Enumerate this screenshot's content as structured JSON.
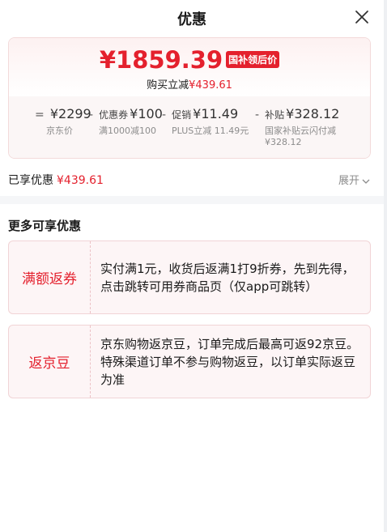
{
  "header": {
    "title": "优惠"
  },
  "price_card": {
    "final_price": "¥1859.39",
    "final_tag": "国补领后价",
    "save_label": "购买立减",
    "save_amount": "¥439.61",
    "breakdown": [
      {
        "op": "=",
        "prefix": "",
        "value": "¥2299",
        "caption": "京东价"
      },
      {
        "op": "-",
        "prefix": "优惠券",
        "value": "¥100",
        "caption": "满1000减100"
      },
      {
        "op": "-",
        "prefix": "促销",
        "value": "¥11.49",
        "caption": "PLUS立减 11.49元"
      },
      {
        "op": "-",
        "prefix": "补贴",
        "value": "¥328.12",
        "caption": "国家补贴云闪付减¥328.12"
      }
    ]
  },
  "summary": {
    "label": "已享优惠",
    "amount": "¥439.61",
    "expand_label": "展开"
  },
  "more": {
    "title": "更多可享优惠",
    "items": [
      {
        "name": "满额返券",
        "desc": "实付满1元，收货后返满1打9折券，先到先得，点击跳转可用券商品页（仅app可跳转）"
      },
      {
        "name": "返京豆",
        "desc": "京东购物返京豆，订单完成后最高可返92京豆。特殊渠道订单不参与购物返豆，以订单实际返豆为准"
      }
    ]
  },
  "colors": {
    "accent": "#e4202d",
    "muted": "#8c8c8c"
  },
  "icons": {
    "close": "close-icon",
    "expand": "chevron-down-icon"
  }
}
